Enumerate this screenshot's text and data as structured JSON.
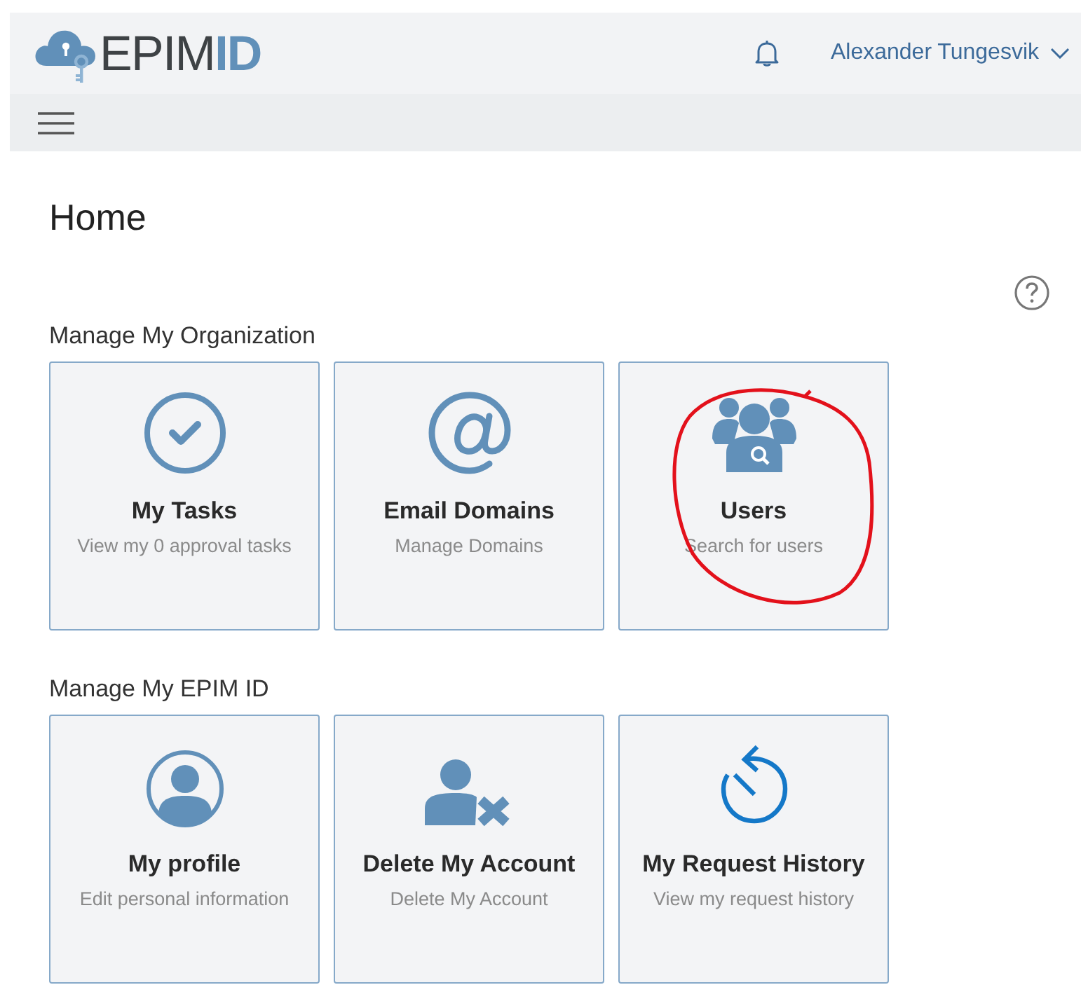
{
  "header": {
    "logo": {
      "text": "EPIM",
      "accent": "ID"
    },
    "user": "Alexander Tungesvik"
  },
  "page": {
    "title": "Home"
  },
  "sections": [
    {
      "title": "Manage My Organization",
      "cards": [
        {
          "kind": "check",
          "title": "My Tasks",
          "subtitle": "View my 0 approval tasks",
          "circled": false
        },
        {
          "kind": "at",
          "title": "Email Domains",
          "subtitle": "Manage Domains",
          "circled": false
        },
        {
          "kind": "group",
          "title": "Users",
          "subtitle": "Search for users",
          "circled": true
        }
      ]
    },
    {
      "title": "Manage My EPIM ID",
      "cards": [
        {
          "kind": "person",
          "title": "My profile",
          "subtitle": "Edit personal information",
          "circled": false
        },
        {
          "kind": "remove-person",
          "title": "Delete My Account",
          "subtitle": "Delete My Account",
          "circled": false
        },
        {
          "kind": "history",
          "title": "My Request History",
          "subtitle": "View my request history",
          "circled": false
        }
      ]
    }
  ]
}
